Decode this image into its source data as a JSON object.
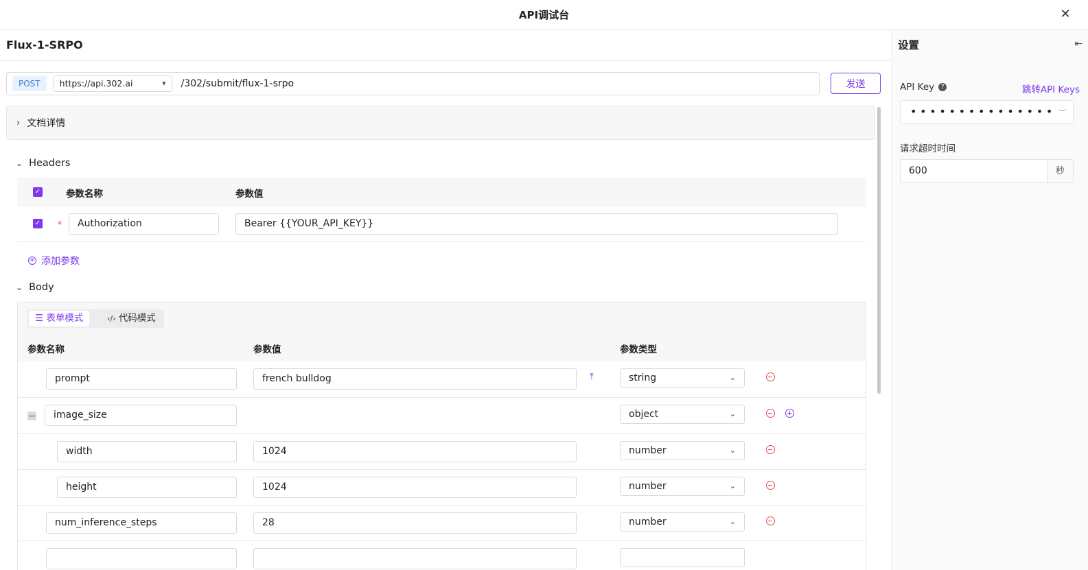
{
  "window": {
    "title": "API调试台"
  },
  "model": {
    "name": "Flux-1-SRPO"
  },
  "request": {
    "method": "POST",
    "base_url": "https://api.302.ai",
    "path": "/302/submit/flux-1-srpo",
    "send_label": "发送"
  },
  "doc_details": {
    "label": "文档详情"
  },
  "headers": {
    "title": "Headers",
    "col_name": "参数名称",
    "col_value": "参数值",
    "rows": [
      {
        "name": "Authorization",
        "value": "Bearer {{YOUR_API_KEY}}",
        "required": "*"
      }
    ],
    "add_label": "添加参数"
  },
  "body": {
    "title": "Body",
    "mode_form": "表单模式",
    "mode_code": "代码模式",
    "col_name": "参数名称",
    "col_value": "参数值",
    "col_type": "参数类型",
    "rows": [
      {
        "name": "prompt",
        "value": "french bulldog",
        "type": "string"
      },
      {
        "name": "image_size",
        "value": "",
        "type": "object"
      },
      {
        "name": "width",
        "value": "1024",
        "type": "number"
      },
      {
        "name": "height",
        "value": "1024",
        "type": "number"
      },
      {
        "name": "num_inference_steps",
        "value": "28",
        "type": "number"
      }
    ]
  },
  "settings": {
    "title": "设置",
    "api_key_label": "API Key",
    "jump_label": "跳转API Keys",
    "api_key_masked": "•••••••••••••••",
    "timeout_label": "请求超时时间",
    "timeout_value": "600",
    "timeout_unit": "秒"
  },
  "colors": {
    "accent": "#7c3aed",
    "danger": "#e5484d",
    "method_blue": "#3d7fd6"
  }
}
